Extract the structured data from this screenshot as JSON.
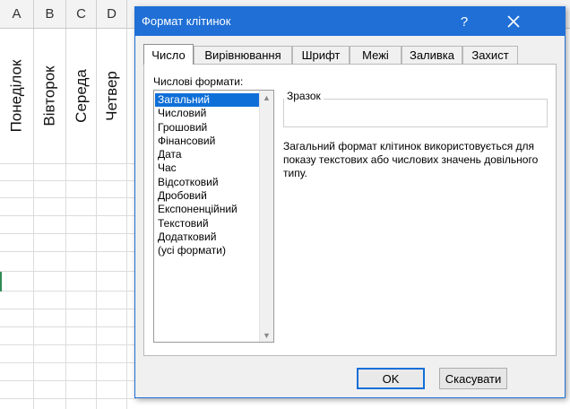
{
  "sheet": {
    "column_headers": [
      "A",
      "B",
      "C",
      "D"
    ],
    "day_headers": [
      "Понеділок",
      "Вівторок",
      "Середа",
      "Четвер"
    ]
  },
  "dialog": {
    "title": "Формат клітинок",
    "help_label": "?",
    "close_icon": "close-icon",
    "tabs": [
      {
        "label": "Число",
        "active": true
      },
      {
        "label": "Вирівнювання",
        "active": false
      },
      {
        "label": "Шрифт",
        "active": false
      },
      {
        "label": "Межі",
        "active": false
      },
      {
        "label": "Заливка",
        "active": false
      },
      {
        "label": "Захист",
        "active": false
      }
    ],
    "category_label": "Числові формати:",
    "categories": [
      "Загальний",
      "Числовий",
      "Грошовий",
      "Фінансовий",
      "Дата",
      "Час",
      "Відсотковий",
      "Дробовий",
      "Експоненційний",
      "Текстовий",
      "Додатковий",
      "(усі формати)"
    ],
    "selected_category": "Загальний",
    "sample_label": "Зразок",
    "description": "Загальний формат клітинок використовується для показу текстових або числових значень довільного типу.",
    "ok_label": "OK",
    "cancel_label": "Скасувати",
    "accent_color": "#1f6fd6",
    "selection_color": "#0f6fd8"
  }
}
